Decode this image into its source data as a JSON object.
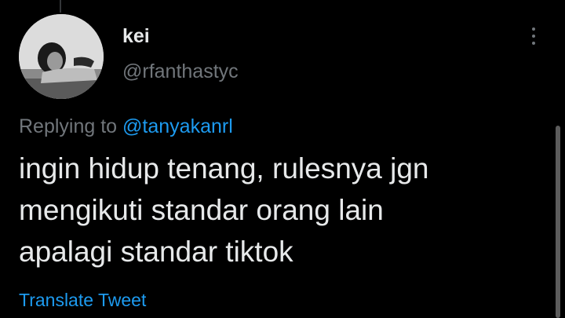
{
  "author": {
    "display_name": "kei",
    "handle": "@rfanthastyc"
  },
  "reply": {
    "prefix": "Replying to",
    "mention": "@tanyakanrl"
  },
  "tweet": {
    "lines": [
      "ingin hidup tenang, rulesnya jgn",
      "mengikuti standar orang lain",
      "apalagi standar tiktok"
    ]
  },
  "translate_label": "Translate Tweet",
  "icons": {
    "more": "more-vertical-icon"
  },
  "colors": {
    "background": "#000000",
    "primary_text": "#e7e9ea",
    "secondary_text": "#71767b",
    "accent": "#1d9bf0"
  }
}
